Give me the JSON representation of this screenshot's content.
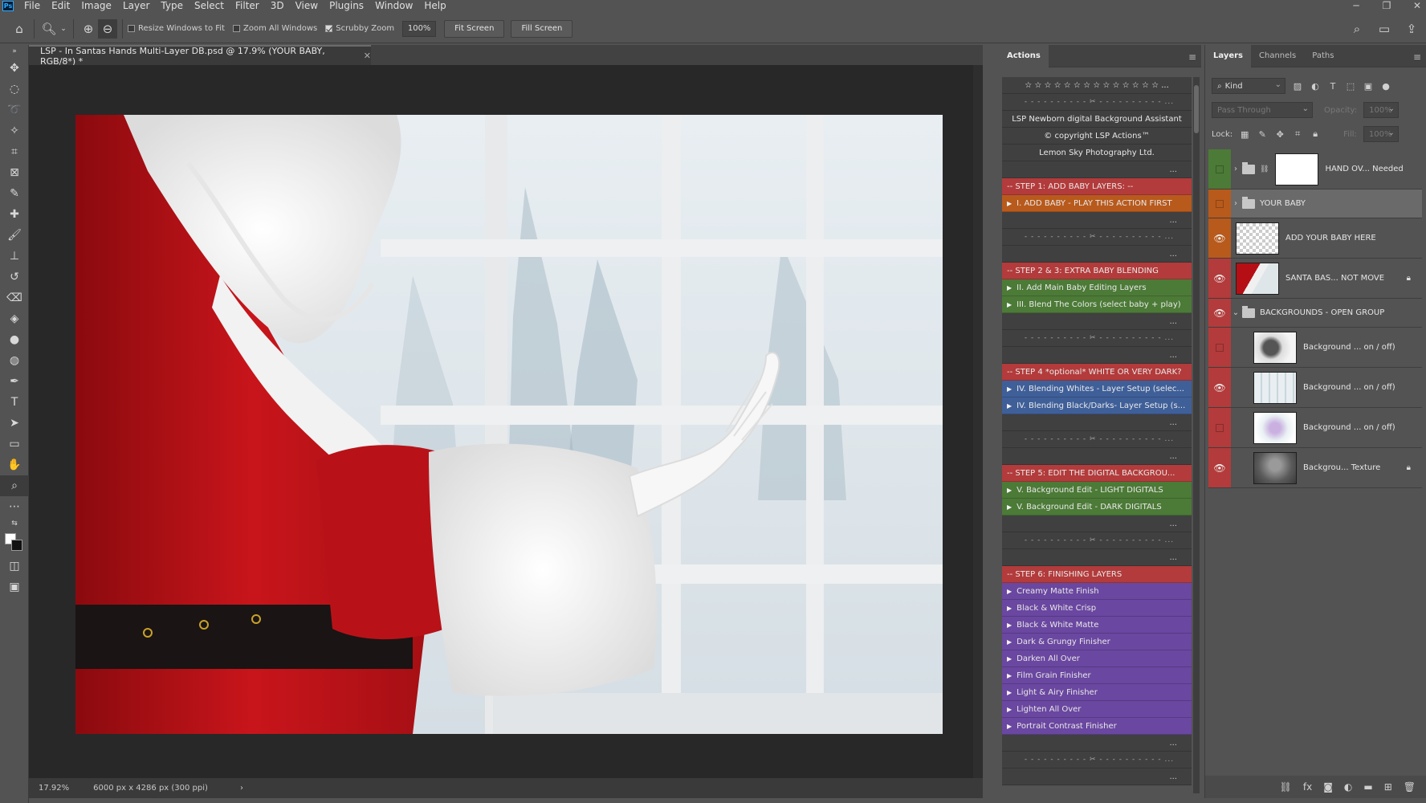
{
  "menu": [
    "File",
    "Edit",
    "Image",
    "Layer",
    "Type",
    "Select",
    "Filter",
    "3D",
    "View",
    "Plugins",
    "Window",
    "Help"
  ],
  "app_logo": "Ps",
  "window_controls": [
    "─",
    "❐",
    "✕"
  ],
  "options": {
    "resize_windows": "Resize Windows to Fit",
    "zoom_all": "Zoom All Windows",
    "scrubby_zoom": "Scrubby Zoom",
    "zoom_value": "100%",
    "fit_screen": "Fit Screen",
    "fill_screen": "Fill Screen"
  },
  "document": {
    "tab_title": "LSP - In Santas Hands Multi-Layer DB.psd @ 17.9% (YOUR BABY, RGB/8*) *",
    "zoom": "17.92%",
    "dimensions": "6000 px x 4286 px (300 ppi)"
  },
  "actions": {
    "tab": "Actions",
    "rows": [
      {
        "text": "☆ ☆ ☆ ☆ ☆ ☆ ☆ ☆ ☆ ☆ ☆ ☆ ☆ ☆ ...",
        "kind": "center",
        "color": ""
      },
      {
        "text": "- - - - - - - - - - ✂ - - - - - - - - - - ...",
        "kind": "dashed",
        "color": ""
      },
      {
        "text": "LSP Newborn digital Background Assistant",
        "kind": "center",
        "color": ""
      },
      {
        "text": "© copyright LSP Actions™",
        "kind": "center",
        "color": ""
      },
      {
        "text": "Lemon Sky Photography Ltd.",
        "kind": "center",
        "color": ""
      },
      {
        "text": "...",
        "kind": "dots",
        "color": ""
      },
      {
        "text": "-- STEP 1: ADD BABY LAYERS: --",
        "kind": "plain",
        "color": "red"
      },
      {
        "text": "I. ADD BABY - PLAY THIS ACTION FIRST",
        "kind": "tri",
        "color": "orange"
      },
      {
        "text": "...",
        "kind": "dots",
        "color": ""
      },
      {
        "text": "- - - - - - - - - - ✂ - - - - - - - - - - ...",
        "kind": "dashed",
        "color": ""
      },
      {
        "text": "...",
        "kind": "dots",
        "color": ""
      },
      {
        "text": "-- STEP 2 & 3: EXTRA BABY BLENDING",
        "kind": "plain",
        "color": "red"
      },
      {
        "text": "II.  Add Main Baby Editing Layers",
        "kind": "tri",
        "color": "green"
      },
      {
        "text": "III. Blend The Colors (select baby + play)",
        "kind": "tri",
        "color": "green"
      },
      {
        "text": "...",
        "kind": "dots",
        "color": ""
      },
      {
        "text": "- - - - - - - - - - ✂ - - - - - - - - - - ...",
        "kind": "dashed",
        "color": ""
      },
      {
        "text": "...",
        "kind": "dots",
        "color": ""
      },
      {
        "text": "-- STEP 4 *optional* WHITE OR VERY DARK?",
        "kind": "plain",
        "color": "red"
      },
      {
        "text": "IV. Blending Whites - Layer Setup (selec...",
        "kind": "tri",
        "color": "blue"
      },
      {
        "text": "IV. Blending Black/Darks- Layer Setup (s...",
        "kind": "tri",
        "color": "blue"
      },
      {
        "text": "...",
        "kind": "dots",
        "color": ""
      },
      {
        "text": "- - - - - - - - - - ✂ - - - - - - - - - - ...",
        "kind": "dashed",
        "color": ""
      },
      {
        "text": "...",
        "kind": "dots",
        "color": ""
      },
      {
        "text": "-- STEP 5: EDIT THE DIGITAL BACKGROU...",
        "kind": "plain",
        "color": "red"
      },
      {
        "text": "V. Background Edit - LIGHT DIGITALS",
        "kind": "tri",
        "color": "green"
      },
      {
        "text": "V. Background Edit - DARK DIGITALS",
        "kind": "tri",
        "color": "green"
      },
      {
        "text": "...",
        "kind": "dots",
        "color": ""
      },
      {
        "text": "- - - - - - - - - - ✂ - - - - - - - - - - ...",
        "kind": "dashed",
        "color": ""
      },
      {
        "text": "...",
        "kind": "dots",
        "color": ""
      },
      {
        "text": "-- STEP 6: FINISHING LAYERS",
        "kind": "plain",
        "color": "red"
      },
      {
        "text": "Creamy Matte Finish",
        "kind": "tri",
        "color": "violet"
      },
      {
        "text": "Black & White Crisp",
        "kind": "tri",
        "color": "violet"
      },
      {
        "text": "Black & White Matte",
        "kind": "tri",
        "color": "violet"
      },
      {
        "text": "Dark & Grungy Finisher",
        "kind": "tri",
        "color": "violet"
      },
      {
        "text": "Darken All Over",
        "kind": "tri",
        "color": "violet"
      },
      {
        "text": "Film Grain Finisher",
        "kind": "tri",
        "color": "violet"
      },
      {
        "text": "Light & Airy Finisher",
        "kind": "tri",
        "color": "violet"
      },
      {
        "text": "Lighten All Over",
        "kind": "tri",
        "color": "violet"
      },
      {
        "text": "Portrait Contrast Finisher",
        "kind": "tri",
        "color": "violet"
      },
      {
        "text": "...",
        "kind": "dots",
        "color": ""
      },
      {
        "text": "- - - - - - - - - - ✂ - - - - - - - - - - ...",
        "kind": "dashed",
        "color": ""
      },
      {
        "text": "...",
        "kind": "dots",
        "color": ""
      }
    ]
  },
  "layers": {
    "tabs": [
      "Layers",
      "Channels",
      "Paths"
    ],
    "filter_kind": "Kind",
    "blend_mode": "Pass Through",
    "opacity_label": "Opacity:",
    "opacity_value": "100%",
    "lock_label": "Lock:",
    "fill_label": "Fill:",
    "fill_value": "100%",
    "items": [
      {
        "name": "HAND OV... Needed",
        "type": "group-thumb",
        "eye": "green",
        "visible": false,
        "lock": false,
        "selected": false,
        "indent": false,
        "thumb": "white"
      },
      {
        "name": "YOUR BABY",
        "type": "group",
        "eye": "orange",
        "visible": false,
        "lock": false,
        "selected": true,
        "indent": false,
        "thumb": ""
      },
      {
        "name": "ADD YOUR BABY HERE",
        "type": "layer",
        "eye": "orange",
        "visible": true,
        "lock": false,
        "selected": false,
        "indent": false,
        "thumb": "checker"
      },
      {
        "name": "SANTA BAS... NOT MOVE",
        "type": "layer",
        "eye": "red",
        "visible": true,
        "lock": true,
        "selected": false,
        "indent": false,
        "thumb": "santa"
      },
      {
        "name": "BACKGROUNDS - OPEN GROUP",
        "type": "group-open",
        "eye": "red",
        "visible": true,
        "lock": false,
        "selected": false,
        "indent": false,
        "thumb": ""
      },
      {
        "name": "Background ... on / off)",
        "type": "layer",
        "eye": "red",
        "visible": false,
        "lock": false,
        "selected": false,
        "indent": true,
        "thumb": "bg1"
      },
      {
        "name": "Background ... on / off)",
        "type": "layer",
        "eye": "red",
        "visible": true,
        "lock": false,
        "selected": false,
        "indent": true,
        "thumb": "bg2"
      },
      {
        "name": "Background ... on / off)",
        "type": "layer",
        "eye": "red",
        "visible": false,
        "lock": false,
        "selected": false,
        "indent": true,
        "thumb": "bg3"
      },
      {
        "name": "Backgrou... Texture",
        "type": "layer",
        "eye": "red",
        "visible": true,
        "lock": true,
        "selected": false,
        "indent": true,
        "thumb": "texture"
      }
    ]
  },
  "colors": {
    "red": "#b33b3b",
    "orange": "#b85a1c",
    "green": "#4c7a37",
    "blue": "#3f5f99",
    "violet": "#6a47a0"
  }
}
